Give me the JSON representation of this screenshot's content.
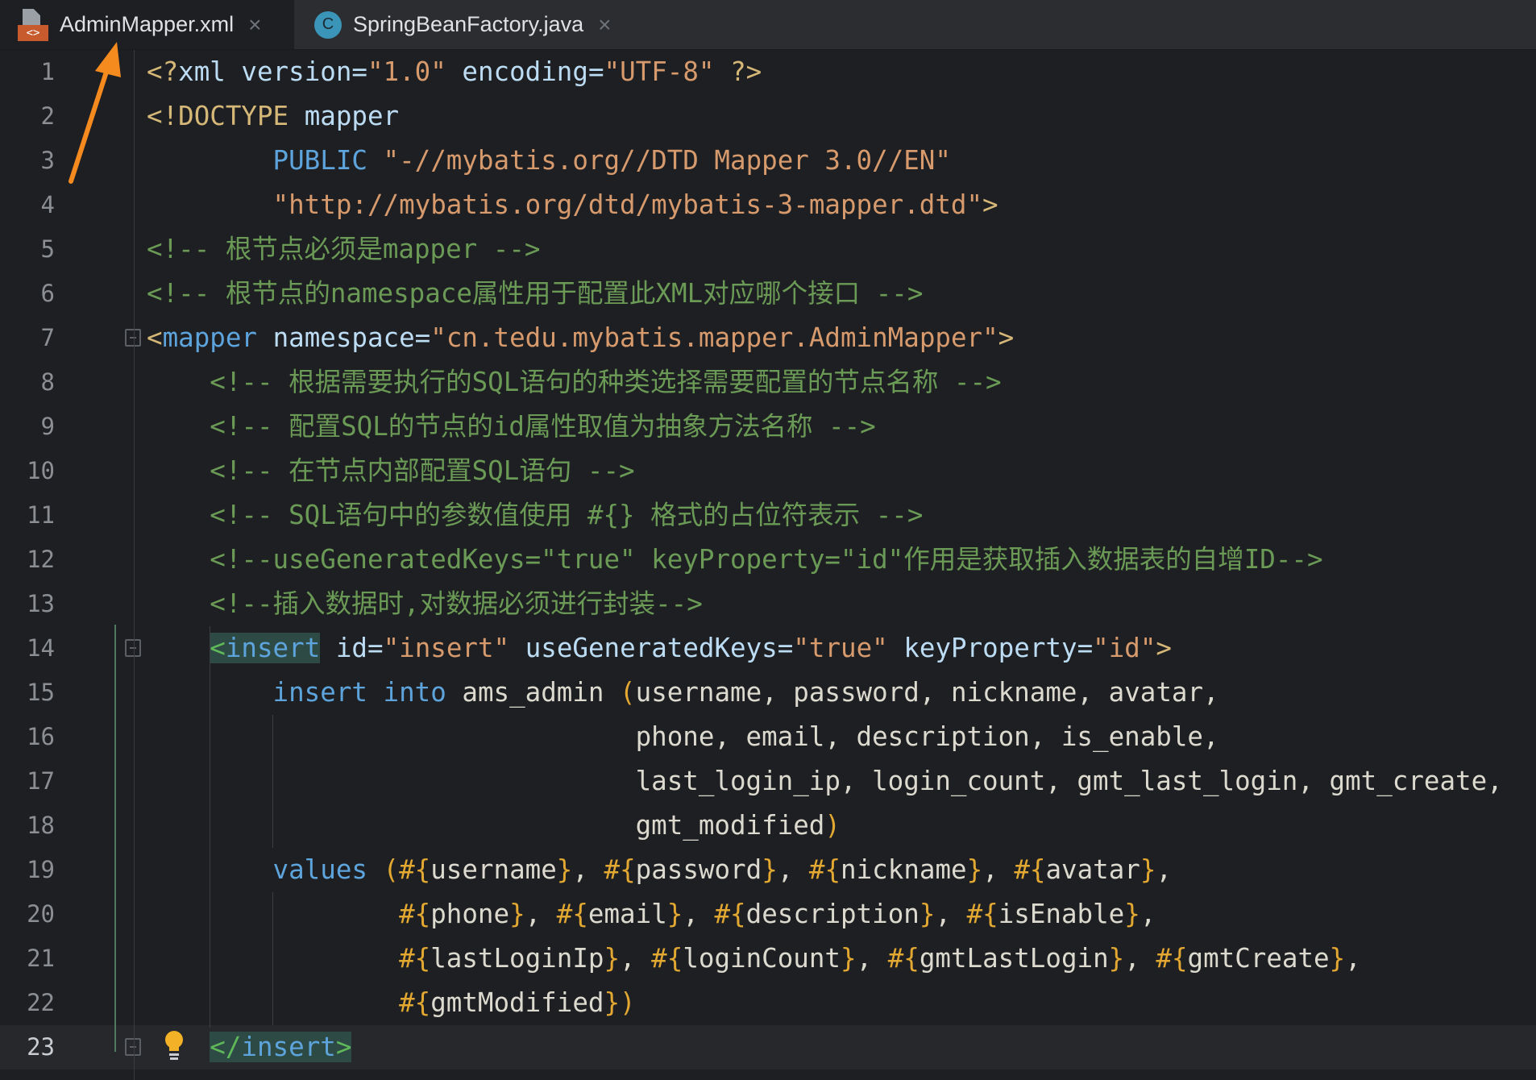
{
  "tabs": [
    {
      "label": "AdminMapper.xml",
      "icon": "xml-file-icon",
      "active": true
    },
    {
      "label": "SpringBeanFactory.java",
      "icon": "java-class-icon",
      "active": false
    }
  ],
  "xml_badge": "<>",
  "java_badge": "C",
  "close_glyph": "×",
  "current_line": 23,
  "lines": [
    [
      [
        "p",
        "<?"
      ],
      [
        "at",
        "xml"
      ],
      [
        "tx",
        " "
      ],
      [
        "at",
        "version"
      ],
      [
        "eq",
        "="
      ],
      [
        "st",
        "\"1.0\""
      ],
      [
        "tx",
        " "
      ],
      [
        "at",
        "encoding"
      ],
      [
        "eq",
        "="
      ],
      [
        "st",
        "\"UTF-8\""
      ],
      [
        "tx",
        " "
      ],
      [
        "p",
        "?>"
      ]
    ],
    [
      [
        "p",
        "<!DOCTYPE"
      ],
      [
        "tx",
        " "
      ],
      [
        "at",
        "mapper"
      ]
    ],
    [
      [
        "tx",
        "        "
      ],
      [
        "kw",
        "PUBLIC"
      ],
      [
        "tx",
        " "
      ],
      [
        "st",
        "\"-//mybatis.org//DTD Mapper 3.0//EN\""
      ]
    ],
    [
      [
        "tx",
        "        "
      ],
      [
        "st",
        "\"http://mybatis.org/dtd/mybatis-3-mapper.dtd\""
      ],
      [
        "p",
        ">"
      ]
    ],
    [
      [
        "cm",
        "<!-- 根节点必须是mapper -->"
      ]
    ],
    [
      [
        "cm",
        "<!-- 根节点的namespace属性用于配置此XML对应哪个接口 -->"
      ]
    ],
    [
      [
        "p",
        "<"
      ],
      [
        "tg",
        "mapper"
      ],
      [
        "tx",
        " "
      ],
      [
        "at",
        "namespace"
      ],
      [
        "eq",
        "="
      ],
      [
        "st",
        "\"cn.tedu.mybatis.mapper.AdminMapper\""
      ],
      [
        "p",
        ">"
      ]
    ],
    [
      [
        "tx",
        "    "
      ],
      [
        "cm",
        "<!-- 根据需要执行的SQL语句的种类选择需要配置的节点名称 -->"
      ]
    ],
    [
      [
        "tx",
        "    "
      ],
      [
        "cm",
        "<!-- 配置SQL的节点的id属性取值为抽象方法名称 -->"
      ]
    ],
    [
      [
        "tx",
        "    "
      ],
      [
        "cm",
        "<!-- 在节点内部配置SQL语句 -->"
      ]
    ],
    [
      [
        "tx",
        "    "
      ],
      [
        "cm",
        "<!-- SQL语句中的参数值使用 #{} 格式的占位符表示 -->"
      ]
    ],
    [
      [
        "tx",
        "    "
      ],
      [
        "cm",
        "<!--useGeneratedKeys=\"true\" keyProperty=\"id\"作用是获取插入数据表的自增ID-->"
      ]
    ],
    [
      [
        "tx",
        "    "
      ],
      [
        "cm",
        "<!--插入数据时,对数据必须进行封装-->"
      ]
    ],
    [
      [
        "tx",
        "    "
      ],
      [
        "hlg",
        "<"
      ],
      [
        "hlt",
        "insert"
      ],
      [
        "tx",
        " "
      ],
      [
        "at",
        "id"
      ],
      [
        "eq",
        "="
      ],
      [
        "st",
        "\"insert\""
      ],
      [
        "tx",
        " "
      ],
      [
        "at",
        "useGeneratedKeys"
      ],
      [
        "eq",
        "="
      ],
      [
        "st",
        "\"true\""
      ],
      [
        "tx",
        " "
      ],
      [
        "at",
        "keyProperty"
      ],
      [
        "eq",
        "="
      ],
      [
        "st",
        "\"id\""
      ],
      [
        "p",
        ">"
      ]
    ],
    [
      [
        "tx",
        "        "
      ],
      [
        "kw",
        "insert"
      ],
      [
        "tx",
        " "
      ],
      [
        "kw",
        "into"
      ],
      [
        "tx",
        " ams_admin "
      ],
      [
        "hs",
        "("
      ],
      [
        "tx",
        "username, password, nickname, avatar,"
      ]
    ],
    [
      [
        "tx",
        "                               phone, email, description, is_enable,"
      ]
    ],
    [
      [
        "tx",
        "                               last_login_ip, login_count, gmt_last_login, gmt_create,"
      ]
    ],
    [
      [
        "tx",
        "                               gmt_modified"
      ],
      [
        "hs",
        ")"
      ]
    ],
    [
      [
        "tx",
        "        "
      ],
      [
        "kw",
        "values"
      ],
      [
        "tx",
        " "
      ],
      [
        "hs",
        "(#{"
      ],
      [
        "tx",
        "username"
      ],
      [
        "hs",
        "}"
      ],
      [
        "tx",
        ", "
      ],
      [
        "hs",
        "#{"
      ],
      [
        "tx",
        "password"
      ],
      [
        "hs",
        "}"
      ],
      [
        "tx",
        ", "
      ],
      [
        "hs",
        "#{"
      ],
      [
        "tx",
        "nickname"
      ],
      [
        "hs",
        "}"
      ],
      [
        "tx",
        ", "
      ],
      [
        "hs",
        "#{"
      ],
      [
        "tx",
        "avatar"
      ],
      [
        "hs",
        "}"
      ],
      [
        "tx",
        ","
      ]
    ],
    [
      [
        "tx",
        "                "
      ],
      [
        "hs",
        "#{"
      ],
      [
        "tx",
        "phone"
      ],
      [
        "hs",
        "}"
      ],
      [
        "tx",
        ", "
      ],
      [
        "hs",
        "#{"
      ],
      [
        "tx",
        "email"
      ],
      [
        "hs",
        "}"
      ],
      [
        "tx",
        ", "
      ],
      [
        "hs",
        "#{"
      ],
      [
        "tx",
        "description"
      ],
      [
        "hs",
        "}"
      ],
      [
        "tx",
        ", "
      ],
      [
        "hs",
        "#{"
      ],
      [
        "tx",
        "isEnable"
      ],
      [
        "hs",
        "}"
      ],
      [
        "tx",
        ","
      ]
    ],
    [
      [
        "tx",
        "                "
      ],
      [
        "hs",
        "#{"
      ],
      [
        "tx",
        "lastLoginIp"
      ],
      [
        "hs",
        "}"
      ],
      [
        "tx",
        ", "
      ],
      [
        "hs",
        "#{"
      ],
      [
        "tx",
        "loginCount"
      ],
      [
        "hs",
        "}"
      ],
      [
        "tx",
        ", "
      ],
      [
        "hs",
        "#{"
      ],
      [
        "tx",
        "gmtLastLogin"
      ],
      [
        "hs",
        "}"
      ],
      [
        "tx",
        ", "
      ],
      [
        "hs",
        "#{"
      ],
      [
        "tx",
        "gmtCreate"
      ],
      [
        "hs",
        "}"
      ],
      [
        "tx",
        ","
      ]
    ],
    [
      [
        "tx",
        "                "
      ],
      [
        "hs",
        "#{"
      ],
      [
        "tx",
        "gmtModified"
      ],
      [
        "hs",
        "})"
      ]
    ],
    [
      [
        "tx",
        "    "
      ],
      [
        "hlg",
        "</"
      ],
      [
        "hlt",
        "insert"
      ],
      [
        "hlg",
        ">"
      ]
    ]
  ],
  "fold_lines": [
    7,
    14,
    23
  ],
  "bulb_line": 23
}
